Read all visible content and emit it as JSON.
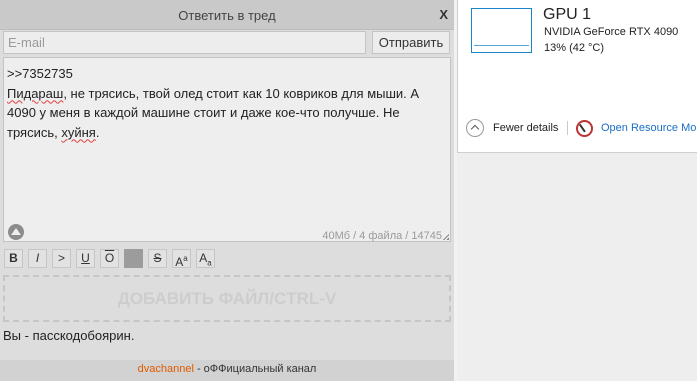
{
  "reply": {
    "title": "Ответить в тред",
    "close": "X",
    "email_placeholder": "E-mail",
    "email_value": "",
    "send": "Отправить",
    "message": {
      "line1": ">>7352735",
      "line2_word1": "Пидараш",
      "line2_rest": ", не трясись, твой олед стоит как 10 ковриков для мыши. А 4090 у меня в каждой машине стоит и даже кое-что получше. Не трясись, ",
      "line2_word2": "хуйня",
      "line2_end": "."
    },
    "limits": "40Мб / 4 файла / 14745"
  },
  "toolbar": {
    "bold": "B",
    "italic": "I",
    "quote": ">",
    "underline": "U",
    "overline": "O",
    "spoiler": "",
    "strike": "S",
    "sup_main": "A",
    "sup_small": "a",
    "sub_main": "A",
    "sub_small": "a"
  },
  "dropzone": "ДОБАВИТЬ ФАЙЛ/CTRL-V",
  "user_note": "Вы - пасскодобоярин.",
  "footer": {
    "link": "dvachannel",
    "text": " - оФФициальный канал"
  },
  "task_manager": {
    "gpu_name": "GPU 1",
    "gpu_model": "NVIDIA GeForce RTX 4090",
    "gpu_usage": "13%  (42 °C)",
    "fewer_details": "Fewer details",
    "resource_monitor": "Open Resource Monitor",
    "accent_color": "#1a84c9",
    "icons": [
      "chevron-up-icon",
      "resource-monitor-icon"
    ]
  },
  "colors": {
    "link_orange": "#e05a00",
    "link_blue": "#1a6fc4",
    "spell_error": "#e04040"
  }
}
